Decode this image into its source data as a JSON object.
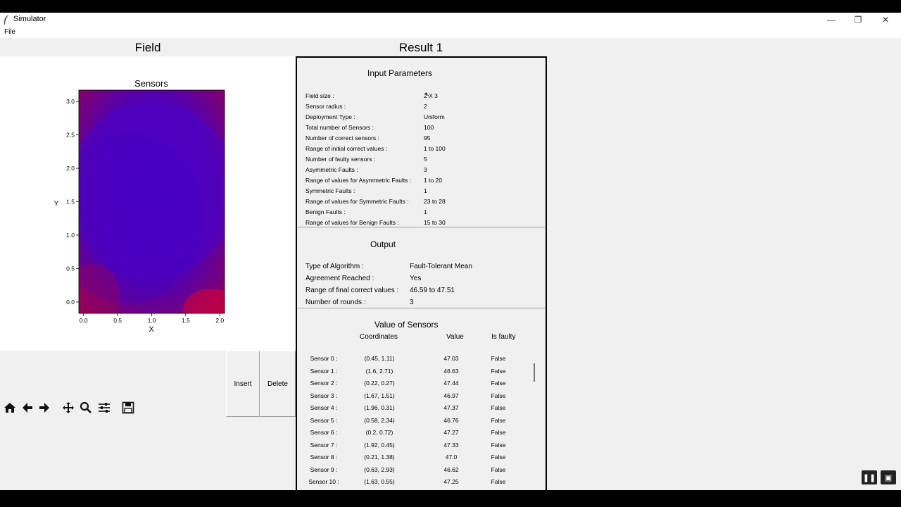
{
  "window": {
    "title": "Simulator",
    "minimize": "—",
    "restore": "❐",
    "close": "✕"
  },
  "menu": {
    "file": "File"
  },
  "field": {
    "title": "Field",
    "plot": {
      "title": "Sensors",
      "xlabel": "X",
      "ylabel": "Y",
      "xticks": [
        "0.0",
        "0.5",
        "1.0",
        "1.5",
        "2.0"
      ],
      "yticks": [
        "0.0",
        "0.5",
        "1.0",
        "1.5",
        "2.0",
        "2.5",
        "3.0"
      ]
    },
    "insert_label": "Insert",
    "delete_label": "Delete",
    "toolbar": [
      "home-icon",
      "back-arrow-icon",
      "forward-arrow-icon",
      "pan-icon",
      "zoom-icon",
      "configure-icon",
      "save-icon"
    ]
  },
  "chart_data": {
    "type": "scatter",
    "title": "Sensors",
    "xlabel": "X",
    "ylabel": "Y",
    "xlim": [
      -0.07,
      2.07
    ],
    "ylim": [
      -0.17,
      3.17
    ],
    "x": [
      0.45,
      1.6,
      0.22,
      1.67,
      1.96,
      0.58,
      0.2,
      1.92,
      0.21,
      0.63,
      1.63
    ],
    "y": [
      1.11,
      2.71,
      0.27,
      1.51,
      0.31,
      2.34,
      0.72,
      0.45,
      1.38,
      2.93,
      0.55
    ],
    "marker_radius": 2,
    "colors": {
      "correct": "#4000b4",
      "faulty": "#ff0000"
    }
  },
  "result": {
    "title": "Result 1",
    "input_parameters": {
      "title": "Input Parameters",
      "rows": [
        {
          "label": "Field size :",
          "value": "2 X 3"
        },
        {
          "label": "Sensor radius :",
          "value": "2"
        },
        {
          "label": "Deployment Type :",
          "value": "Uniform"
        },
        {
          "label": "Total number of Sensors :",
          "value": "100"
        },
        {
          "label": "Number of correct sensors :",
          "value": "95"
        },
        {
          "label": "Range of initial correct values :",
          "value": "1 to 100"
        },
        {
          "label": "Number of faulty sensors :",
          "value": "5"
        },
        {
          "label": "Asymmetric Faults :",
          "value": "3"
        },
        {
          "label": "Range of values for Asymmetric Faults :",
          "value": "1 to 20"
        },
        {
          "label": "Symmetric Faults :",
          "value": "1"
        },
        {
          "label": "Range of values for Symmetric Faults :",
          "value": "23 to 28"
        },
        {
          "label": "Benign Faults :",
          "value": "1"
        },
        {
          "label": "Range of values for Benign Faults :",
          "value": "15 to 30"
        }
      ]
    },
    "output": {
      "title": "Output",
      "rows": [
        {
          "label": "Type of Algorithm :",
          "value": "Fault-Tolerant Mean"
        },
        {
          "label": "Agreement Reached :",
          "value": "Yes"
        },
        {
          "label": "Range of final correct values :",
          "value": "46.59 to 47.51"
        },
        {
          "label": "Number of rounds :",
          "value": "3"
        }
      ]
    },
    "sensors": {
      "title": "Value of Sensors",
      "headers": {
        "coordinates": "Coordinates",
        "value": "Value",
        "faulty": "Is faulty"
      },
      "rows": [
        {
          "name": "Sensor 0 :",
          "coords": "(0.45, 1.11)",
          "value": "47.03",
          "faulty": "False"
        },
        {
          "name": "Sensor 1 :",
          "coords": "(1.6, 2.71)",
          "value": "46.63",
          "faulty": "False"
        },
        {
          "name": "Sensor 2 :",
          "coords": "(0.22, 0.27)",
          "value": "47.44",
          "faulty": "False"
        },
        {
          "name": "Sensor 3 :",
          "coords": "(1.67, 1.51)",
          "value": "46.97",
          "faulty": "False"
        },
        {
          "name": "Sensor 4 :",
          "coords": "(1.96, 0.31)",
          "value": "47.37",
          "faulty": "False"
        },
        {
          "name": "Sensor 5 :",
          "coords": "(0.58, 2.34)",
          "value": "46.76",
          "faulty": "False"
        },
        {
          "name": "Sensor 6 :",
          "coords": "(0.2, 0.72)",
          "value": "47.27",
          "faulty": "False"
        },
        {
          "name": "Sensor 7 :",
          "coords": "(1.92, 0.45)",
          "value": "47.33",
          "faulty": "False"
        },
        {
          "name": "Sensor 8 :",
          "coords": "(0.21, 1.38)",
          "value": "47.0",
          "faulty": "False"
        },
        {
          "name": "Sensor 9 :",
          "coords": "(0.63, 2.93)",
          "value": "46.62",
          "faulty": "False"
        },
        {
          "name": "Sensor 10 :",
          "coords": "(1.63, 0.55)",
          "value": "47.25",
          "faulty": "False"
        }
      ]
    }
  },
  "media": {
    "pause": "❚❚",
    "pip": "▣"
  }
}
